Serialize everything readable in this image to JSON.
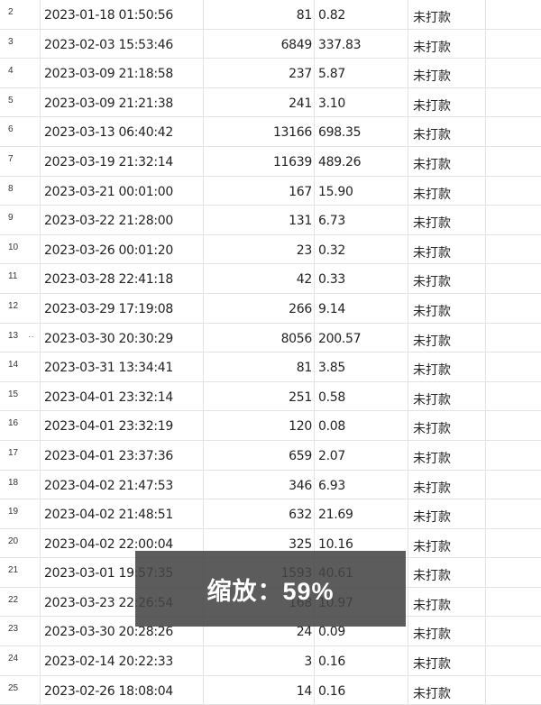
{
  "rows": [
    {
      "num": "2",
      "datetime": "2023-01-18 01:50:56",
      "qty": "81",
      "amount": "0.82",
      "status": "未打款"
    },
    {
      "num": "3",
      "datetime": "2023-02-03 15:53:46",
      "qty": "6849",
      "amount": "337.83",
      "status": "未打款"
    },
    {
      "num": "4",
      "datetime": "2023-03-09 21:18:58",
      "qty": "237",
      "amount": "5.87",
      "status": "未打款"
    },
    {
      "num": "5",
      "datetime": "2023-03-09 21:21:38",
      "qty": "241",
      "amount": "3.10",
      "status": "未打款"
    },
    {
      "num": "6",
      "datetime": "2023-03-13 06:40:42",
      "qty": "13166",
      "amount": "698.35",
      "status": "未打款"
    },
    {
      "num": "7",
      "datetime": "2023-03-19 21:32:14",
      "qty": "11639",
      "amount": "489.26",
      "status": "未打款"
    },
    {
      "num": "8",
      "datetime": "2023-03-21 00:01:00",
      "qty": "167",
      "amount": "15.90",
      "status": "未打款"
    },
    {
      "num": "9",
      "datetime": "2023-03-22 21:28:00",
      "qty": "131",
      "amount": "6.73",
      "status": "未打款"
    },
    {
      "num": "10",
      "datetime": "2023-03-26 00:01:20",
      "qty": "23",
      "amount": "0.32",
      "status": "未打款"
    },
    {
      "num": "11",
      "datetime": "2023-03-28 22:41:18",
      "qty": "42",
      "amount": "0.33",
      "status": "未打款"
    },
    {
      "num": "12",
      "datetime": "2023-03-29 17:19:08",
      "qty": "266",
      "amount": "9.14",
      "status": "未打款"
    },
    {
      "num": "13",
      "datetime": "2023-03-30 20:30:29",
      "qty": "8056",
      "amount": "200.57",
      "status": "未打款",
      "mark": "··"
    },
    {
      "num": "14",
      "datetime": "2023-03-31 13:34:41",
      "qty": "81",
      "amount": "3.85",
      "status": "未打款"
    },
    {
      "num": "15",
      "datetime": "2023-04-01 23:32:14",
      "qty": "251",
      "amount": "0.58",
      "status": "未打款"
    },
    {
      "num": "16",
      "datetime": "2023-04-01 23:32:19",
      "qty": "120",
      "amount": "0.08",
      "status": "未打款"
    },
    {
      "num": "17",
      "datetime": "2023-04-01 23:37:36",
      "qty": "659",
      "amount": "2.07",
      "status": "未打款"
    },
    {
      "num": "18",
      "datetime": "2023-04-02 21:47:53",
      "qty": "346",
      "amount": "6.93",
      "status": "未打款"
    },
    {
      "num": "19",
      "datetime": "2023-04-02 21:48:51",
      "qty": "632",
      "amount": "21.69",
      "status": "未打款"
    },
    {
      "num": "20",
      "datetime": "2023-04-02 22:00:04",
      "qty": "325",
      "amount": "10.16",
      "status": "未打款"
    },
    {
      "num": "21",
      "datetime": "2023-03-01 19:57:35",
      "qty": "1593",
      "amount": "40.61",
      "status": "未打款"
    },
    {
      "num": "22",
      "datetime": "2023-03-23 22:26:54",
      "qty": "168",
      "amount": "10.97",
      "status": "未打款"
    },
    {
      "num": "23",
      "datetime": "2023-03-30 20:28:26",
      "qty": "24",
      "amount": "0.09",
      "status": "未打款"
    },
    {
      "num": "24",
      "datetime": "2023-02-14 20:22:33",
      "qty": "3",
      "amount": "0.16",
      "status": "未打款"
    },
    {
      "num": "25",
      "datetime": "2023-02-26 18:08:04",
      "qty": "14",
      "amount": "0.16",
      "status": "未打款"
    }
  ],
  "zoom_toast": {
    "text": "缩放：59%"
  }
}
